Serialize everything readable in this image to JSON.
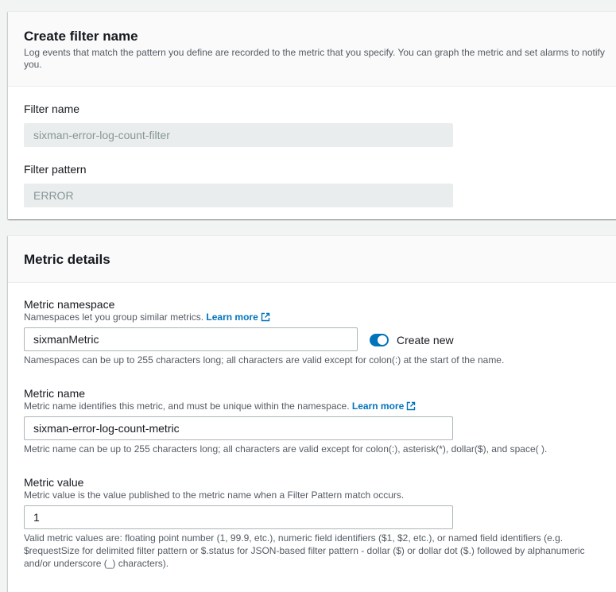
{
  "filter_section": {
    "title": "Create filter name",
    "description": "Log events that match the pattern you define are recorded to the metric that you specify. You can graph the metric and set alarms to notify you.",
    "filter_name": {
      "label": "Filter name",
      "value": "sixman-error-log-count-filter"
    },
    "filter_pattern": {
      "label": "Filter pattern",
      "value": "ERROR"
    }
  },
  "metric_section": {
    "title": "Metric details",
    "namespace": {
      "label": "Metric namespace",
      "help": "Namespaces let you group similar metrics.",
      "learn_more": "Learn more",
      "value": "sixmanMetric",
      "toggle_label": "Create new",
      "toggle_on": true,
      "constraint": "Namespaces can be up to 255 characters long; all characters are valid except for colon(:) at the start of the name."
    },
    "metric_name": {
      "label": "Metric name",
      "help": "Metric name identifies this metric, and must be unique within the namespace.",
      "learn_more": "Learn more",
      "value": "sixman-error-log-count-metric",
      "constraint": "Metric name can be up to 255 characters long; all characters are valid except for colon(:), asterisk(*), dollar($), and space( )."
    },
    "metric_value": {
      "label": "Metric value",
      "help": "Metric value is the value published to the metric name when a Filter Pattern match occurs.",
      "value": "1",
      "constraint": "Valid metric values are: floating point number (1, 99.9, etc.), numeric field identifiers ($1, $2, etc.), or named field identifiers (e.g. $requestSize for delimited filter pattern or $.status for JSON-based filter pattern - dollar ($) or dollar dot ($.) followed by alphanumeric and/or underscore (_) characters)."
    }
  },
  "colors": {
    "accent": "#0073bb",
    "page_bg": "#f2f3f3",
    "panel_bg": "#ffffff",
    "header_bg": "#fafafa",
    "disabled_input_bg": "#eaeded"
  },
  "icons": {
    "external_link": "external-link-icon"
  }
}
